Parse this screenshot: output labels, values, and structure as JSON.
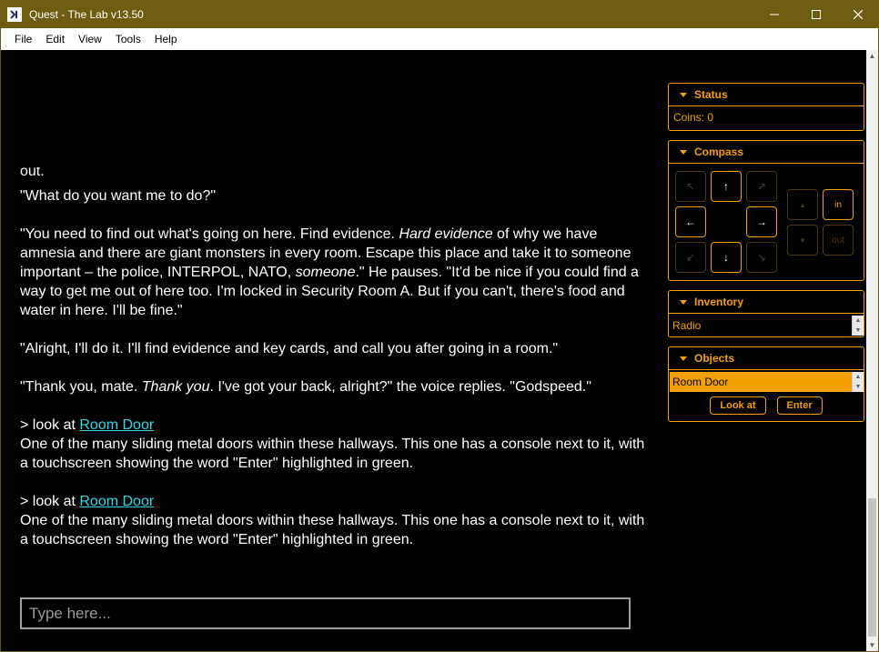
{
  "window": {
    "title": "Quest - The Lab v13.50"
  },
  "menu": [
    "File",
    "Edit",
    "View",
    "Tools",
    "Help"
  ],
  "story": {
    "cut_line": "out.",
    "paragraphs": [
      "\"What do you want me to do?\"",
      "\"You need to find out what's going on here. Find evidence. Hard evidence of why we have amnesia and there are giant monsters in every room. Escape this place and take it to someone important – the police, INTERPOL, NATO, someone.\" He pauses. \"It'd be nice if you could find a way to get me out of here too. I'm locked in Security Room A. But if you can't, there's food and water in here. I'll be fine.\"",
      "\"Alright, I'll do it. I'll find evidence and key cards, and call you after going in a room.\"",
      "\"Thank you, mate. Thank you. I've got your back, alright?\" the voice replies. \"Godspeed.\""
    ],
    "p2_a": "\"You need to find out what's going on here. Find evidence. ",
    "p2_em1": "Hard evidence",
    "p2_b": " of why we have amnesia and there are giant monsters in every room. Escape this place and take it to someone important – the police, INTERPOL, NATO, ",
    "p2_em2": "someone",
    "p2_c": ".\" He pauses. \"It'd be nice if you could find a way to get me out of here too. I'm locked in Security Room A. But if you can't, there's food and water in here. I'll be fine.\"",
    "p4_a": "\"Thank you, mate. ",
    "p4_em": "Thank you",
    "p4_b": ". I've got your back, alright?\" the voice replies. \"Godspeed.\"",
    "commands": [
      {
        "prompt": "> look at ",
        "link": "Room Door",
        "response": "One of the many sliding metal doors within these hallways. This one has a console next to it, with a touchscreen showing the word \"Enter\" highlighted in green."
      },
      {
        "prompt": "> look at ",
        "link": "Room Door",
        "response": "One of the many sliding metal doors within these hallways. This one has a console next to it, with a touchscreen showing the word \"Enter\" highlighted in green."
      }
    ]
  },
  "input": {
    "placeholder": "Type here..."
  },
  "status": {
    "title": "Status",
    "coins_line": "Coins: 0"
  },
  "compass": {
    "title": "Compass",
    "north": "↑",
    "south": "↓",
    "west": "←",
    "east": "→",
    "northwest": "↖",
    "northeast": "↗",
    "southwest": "↙",
    "southeast": "↘",
    "up": "▲",
    "down": "▼",
    "in": "in",
    "out": "out"
  },
  "inventory": {
    "title": "Inventory",
    "selected": "Radio"
  },
  "objects": {
    "title": "Objects",
    "selected": "Room Door",
    "look_at_label": "Look at",
    "enter_label": "Enter"
  },
  "colors": {
    "accent": "#f5a000",
    "link": "#33d6e8",
    "titlebar": "#6e5c10",
    "background": "#000000"
  }
}
